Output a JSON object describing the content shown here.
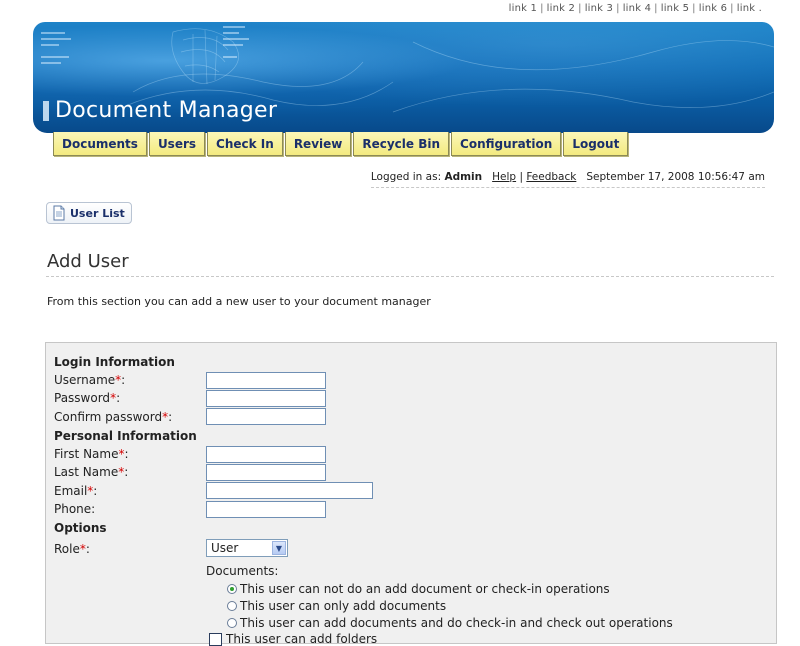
{
  "top_links": [
    "link 1",
    "link 2",
    "link 3",
    "link 4",
    "link 5",
    "link 6",
    "link ."
  ],
  "app": {
    "title": "Document Manager"
  },
  "nav": {
    "tabs": [
      "Documents",
      "Users",
      "Check In",
      "Review",
      "Recycle Bin",
      "Configuration",
      "Logout"
    ]
  },
  "status": {
    "logged_in_prefix": "Logged in as:",
    "user": "Admin",
    "help": "Help",
    "feedback": "Feedback",
    "datetime": "September 17, 2008 10:56:47 am"
  },
  "toolbar": {
    "user_list_label": "User List"
  },
  "page": {
    "title": "Add User",
    "intro": "From this section you can add a new user to your document manager"
  },
  "form": {
    "login_section": "Login Information",
    "username_label": "Username",
    "password_label": "Password",
    "confirm_password_label": "Confirm password",
    "personal_section": "Personal Information",
    "first_name_label": "First Name",
    "last_name_label": "Last Name",
    "email_label": "Email",
    "phone_label": "Phone:",
    "options_section": "Options",
    "role_label": "Role",
    "role_value": "User",
    "documents_label": "Documents:",
    "radio_options": [
      "This user can not do an add document or check-in operations",
      "This user can only add documents",
      "This user can add documents and do check-in and check out operations"
    ],
    "selected_radio": 0,
    "checkbox_label": "This user can add folders"
  },
  "colors": {
    "banner": "#0f6db6",
    "tab_bg": "#f3ea80",
    "tab_text": "#1a2f6a",
    "required": "#d40000",
    "panel_bg": "#f0f0f0"
  }
}
